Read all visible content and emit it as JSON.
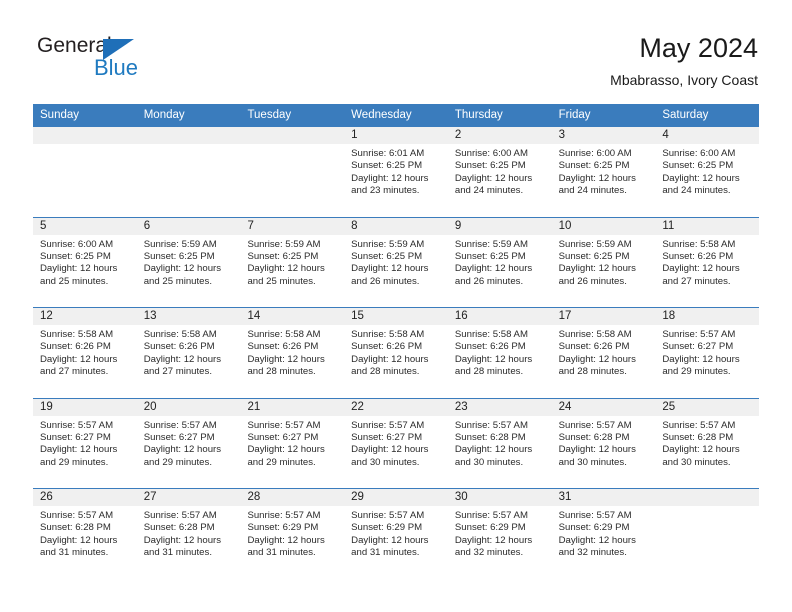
{
  "brand": {
    "name_part1": "General",
    "name_part2": "Blue",
    "triangle_icon": "triangle-icon",
    "accent_color": "#1f7ac0"
  },
  "header": {
    "title": "May 2024",
    "subtitle": "Mbabrasso, Ivory Coast"
  },
  "calendar": {
    "header_color": "#3a7cbd",
    "weekdays": [
      "Sunday",
      "Monday",
      "Tuesday",
      "Wednesday",
      "Thursday",
      "Friday",
      "Saturday"
    ],
    "weeks": [
      [
        {
          "date": "",
          "sunrise": "",
          "sunset": "",
          "daylight_line1": "",
          "daylight_line2": ""
        },
        {
          "date": "",
          "sunrise": "",
          "sunset": "",
          "daylight_line1": "",
          "daylight_line2": ""
        },
        {
          "date": "",
          "sunrise": "",
          "sunset": "",
          "daylight_line1": "",
          "daylight_line2": ""
        },
        {
          "date": "1",
          "sunrise": "Sunrise: 6:01 AM",
          "sunset": "Sunset: 6:25 PM",
          "daylight_line1": "Daylight: 12 hours",
          "daylight_line2": "and 23 minutes."
        },
        {
          "date": "2",
          "sunrise": "Sunrise: 6:00 AM",
          "sunset": "Sunset: 6:25 PM",
          "daylight_line1": "Daylight: 12 hours",
          "daylight_line2": "and 24 minutes."
        },
        {
          "date": "3",
          "sunrise": "Sunrise: 6:00 AM",
          "sunset": "Sunset: 6:25 PM",
          "daylight_line1": "Daylight: 12 hours",
          "daylight_line2": "and 24 minutes."
        },
        {
          "date": "4",
          "sunrise": "Sunrise: 6:00 AM",
          "sunset": "Sunset: 6:25 PM",
          "daylight_line1": "Daylight: 12 hours",
          "daylight_line2": "and 24 minutes."
        }
      ],
      [
        {
          "date": "5",
          "sunrise": "Sunrise: 6:00 AM",
          "sunset": "Sunset: 6:25 PM",
          "daylight_line1": "Daylight: 12 hours",
          "daylight_line2": "and 25 minutes."
        },
        {
          "date": "6",
          "sunrise": "Sunrise: 5:59 AM",
          "sunset": "Sunset: 6:25 PM",
          "daylight_line1": "Daylight: 12 hours",
          "daylight_line2": "and 25 minutes."
        },
        {
          "date": "7",
          "sunrise": "Sunrise: 5:59 AM",
          "sunset": "Sunset: 6:25 PM",
          "daylight_line1": "Daylight: 12 hours",
          "daylight_line2": "and 25 minutes."
        },
        {
          "date": "8",
          "sunrise": "Sunrise: 5:59 AM",
          "sunset": "Sunset: 6:25 PM",
          "daylight_line1": "Daylight: 12 hours",
          "daylight_line2": "and 26 minutes."
        },
        {
          "date": "9",
          "sunrise": "Sunrise: 5:59 AM",
          "sunset": "Sunset: 6:25 PM",
          "daylight_line1": "Daylight: 12 hours",
          "daylight_line2": "and 26 minutes."
        },
        {
          "date": "10",
          "sunrise": "Sunrise: 5:59 AM",
          "sunset": "Sunset: 6:25 PM",
          "daylight_line1": "Daylight: 12 hours",
          "daylight_line2": "and 26 minutes."
        },
        {
          "date": "11",
          "sunrise": "Sunrise: 5:58 AM",
          "sunset": "Sunset: 6:26 PM",
          "daylight_line1": "Daylight: 12 hours",
          "daylight_line2": "and 27 minutes."
        }
      ],
      [
        {
          "date": "12",
          "sunrise": "Sunrise: 5:58 AM",
          "sunset": "Sunset: 6:26 PM",
          "daylight_line1": "Daylight: 12 hours",
          "daylight_line2": "and 27 minutes."
        },
        {
          "date": "13",
          "sunrise": "Sunrise: 5:58 AM",
          "sunset": "Sunset: 6:26 PM",
          "daylight_line1": "Daylight: 12 hours",
          "daylight_line2": "and 27 minutes."
        },
        {
          "date": "14",
          "sunrise": "Sunrise: 5:58 AM",
          "sunset": "Sunset: 6:26 PM",
          "daylight_line1": "Daylight: 12 hours",
          "daylight_line2": "and 28 minutes."
        },
        {
          "date": "15",
          "sunrise": "Sunrise: 5:58 AM",
          "sunset": "Sunset: 6:26 PM",
          "daylight_line1": "Daylight: 12 hours",
          "daylight_line2": "and 28 minutes."
        },
        {
          "date": "16",
          "sunrise": "Sunrise: 5:58 AM",
          "sunset": "Sunset: 6:26 PM",
          "daylight_line1": "Daylight: 12 hours",
          "daylight_line2": "and 28 minutes."
        },
        {
          "date": "17",
          "sunrise": "Sunrise: 5:58 AM",
          "sunset": "Sunset: 6:26 PM",
          "daylight_line1": "Daylight: 12 hours",
          "daylight_line2": "and 28 minutes."
        },
        {
          "date": "18",
          "sunrise": "Sunrise: 5:57 AM",
          "sunset": "Sunset: 6:27 PM",
          "daylight_line1": "Daylight: 12 hours",
          "daylight_line2": "and 29 minutes."
        }
      ],
      [
        {
          "date": "19",
          "sunrise": "Sunrise: 5:57 AM",
          "sunset": "Sunset: 6:27 PM",
          "daylight_line1": "Daylight: 12 hours",
          "daylight_line2": "and 29 minutes."
        },
        {
          "date": "20",
          "sunrise": "Sunrise: 5:57 AM",
          "sunset": "Sunset: 6:27 PM",
          "daylight_line1": "Daylight: 12 hours",
          "daylight_line2": "and 29 minutes."
        },
        {
          "date": "21",
          "sunrise": "Sunrise: 5:57 AM",
          "sunset": "Sunset: 6:27 PM",
          "daylight_line1": "Daylight: 12 hours",
          "daylight_line2": "and 29 minutes."
        },
        {
          "date": "22",
          "sunrise": "Sunrise: 5:57 AM",
          "sunset": "Sunset: 6:27 PM",
          "daylight_line1": "Daylight: 12 hours",
          "daylight_line2": "and 30 minutes."
        },
        {
          "date": "23",
          "sunrise": "Sunrise: 5:57 AM",
          "sunset": "Sunset: 6:28 PM",
          "daylight_line1": "Daylight: 12 hours",
          "daylight_line2": "and 30 minutes."
        },
        {
          "date": "24",
          "sunrise": "Sunrise: 5:57 AM",
          "sunset": "Sunset: 6:28 PM",
          "daylight_line1": "Daylight: 12 hours",
          "daylight_line2": "and 30 minutes."
        },
        {
          "date": "25",
          "sunrise": "Sunrise: 5:57 AM",
          "sunset": "Sunset: 6:28 PM",
          "daylight_line1": "Daylight: 12 hours",
          "daylight_line2": "and 30 minutes."
        }
      ],
      [
        {
          "date": "26",
          "sunrise": "Sunrise: 5:57 AM",
          "sunset": "Sunset: 6:28 PM",
          "daylight_line1": "Daylight: 12 hours",
          "daylight_line2": "and 31 minutes."
        },
        {
          "date": "27",
          "sunrise": "Sunrise: 5:57 AM",
          "sunset": "Sunset: 6:28 PM",
          "daylight_line1": "Daylight: 12 hours",
          "daylight_line2": "and 31 minutes."
        },
        {
          "date": "28",
          "sunrise": "Sunrise: 5:57 AM",
          "sunset": "Sunset: 6:29 PM",
          "daylight_line1": "Daylight: 12 hours",
          "daylight_line2": "and 31 minutes."
        },
        {
          "date": "29",
          "sunrise": "Sunrise: 5:57 AM",
          "sunset": "Sunset: 6:29 PM",
          "daylight_line1": "Daylight: 12 hours",
          "daylight_line2": "and 31 minutes."
        },
        {
          "date": "30",
          "sunrise": "Sunrise: 5:57 AM",
          "sunset": "Sunset: 6:29 PM",
          "daylight_line1": "Daylight: 12 hours",
          "daylight_line2": "and 32 minutes."
        },
        {
          "date": "31",
          "sunrise": "Sunrise: 5:57 AM",
          "sunset": "Sunset: 6:29 PM",
          "daylight_line1": "Daylight: 12 hours",
          "daylight_line2": "and 32 minutes."
        },
        {
          "date": "",
          "sunrise": "",
          "sunset": "",
          "daylight_line1": "",
          "daylight_line2": ""
        }
      ]
    ]
  }
}
